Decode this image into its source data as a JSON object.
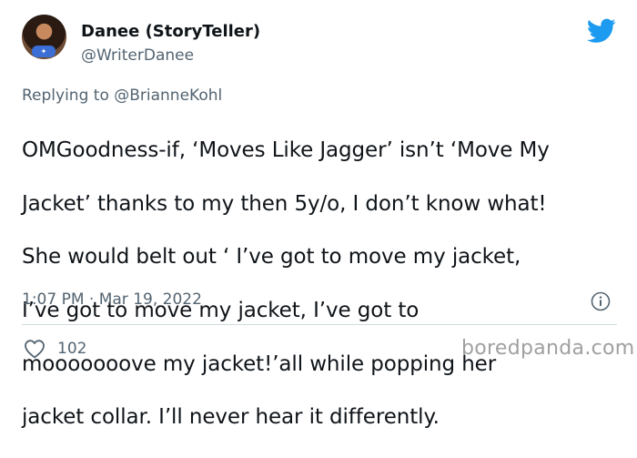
{
  "author": {
    "name": "Danee (StoryTeller)",
    "handle": "@WriterDanee"
  },
  "tweet": {
    "replying_to": "Replying to @BrianneKohl",
    "text_lines": [
      "OMGoodness-if, ‘Moves Like Jagger’ isn’t ‘Move My",
      "Jacket’ thanks to my then 5y/o, I don’t know what!",
      "She would belt out ‘ I’ve got to move my jacket,",
      "I’ve got to move my jacket, I’ve got to",
      "mooooooove my jacket!’all while popping her",
      "jacket collar. I’ll never hear it differently."
    ],
    "timestamp": "1:07 PM · Mar 19, 2022"
  },
  "engagement": {
    "likes": "102"
  },
  "watermark": "boredpanda.com",
  "colors": {
    "twitter_blue": "#1d9bf0",
    "secondary_text": "#536471",
    "primary_text": "#0f1419"
  },
  "icons": {
    "brand": "twitter-bird-icon",
    "info": "info-icon",
    "like": "heart-icon"
  }
}
